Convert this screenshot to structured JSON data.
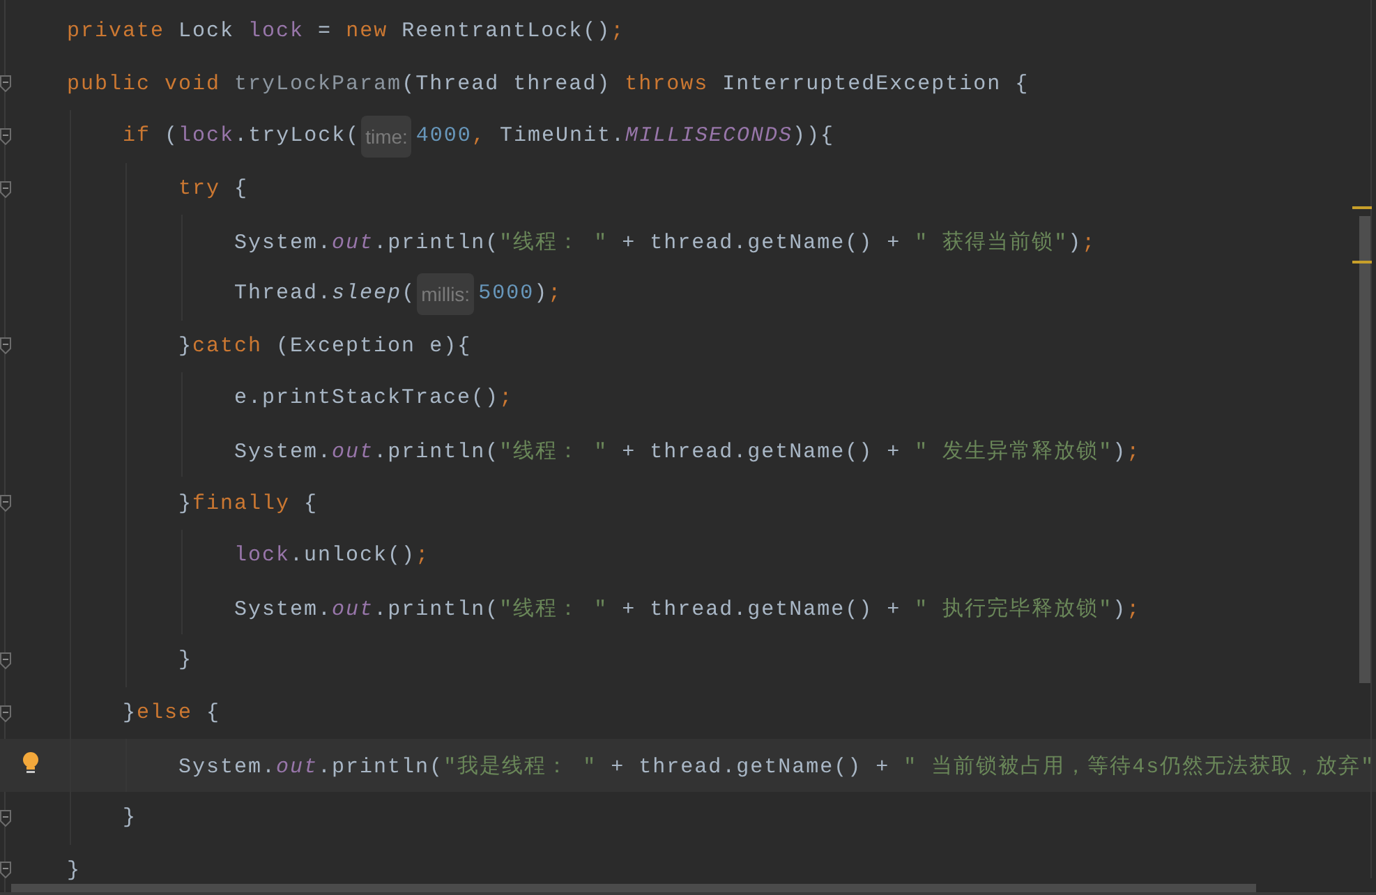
{
  "lines": [
    {
      "fold": false,
      "current": false,
      "intention_bulb": false,
      "tokens": [
        {
          "kind": "keyword",
          "text": "private"
        },
        {
          "kind": "plain",
          "text": " Lock "
        },
        {
          "kind": "field",
          "text": "lock"
        },
        {
          "kind": "plain",
          "text": " = "
        },
        {
          "kind": "keyword",
          "text": "new"
        },
        {
          "kind": "plain",
          "text": " ReentrantLock()"
        },
        {
          "kind": "keyword",
          "text": ";"
        }
      ]
    },
    {
      "fold": true,
      "current": false,
      "intention_bulb": false,
      "tokens": [
        {
          "kind": "keyword",
          "text": "public void "
        },
        {
          "kind": "declaration",
          "text": "tryLockParam"
        },
        {
          "kind": "plain",
          "text": "(Thread thread) "
        },
        {
          "kind": "keyword",
          "text": "throws"
        },
        {
          "kind": "plain",
          "text": " InterruptedException {"
        }
      ]
    },
    {
      "fold": true,
      "current": false,
      "intention_bulb": false,
      "tokens": [
        {
          "kind": "keyword",
          "text": "    if"
        },
        {
          "kind": "plain",
          "text": " ("
        },
        {
          "kind": "field",
          "text": "lock"
        },
        {
          "kind": "plain",
          "text": ".tryLock("
        },
        {
          "kind": "hint",
          "text": "time:"
        },
        {
          "kind": "number",
          "text": "4000"
        },
        {
          "kind": "keyword",
          "text": ","
        },
        {
          "kind": "plain",
          "text": " TimeUnit."
        },
        {
          "kind": "static-field",
          "text": "MILLISECONDS"
        },
        {
          "kind": "plain",
          "text": ")){"
        }
      ]
    },
    {
      "fold": true,
      "current": false,
      "intention_bulb": false,
      "tokens": [
        {
          "kind": "keyword",
          "text": "        try"
        },
        {
          "kind": "plain",
          "text": " {"
        }
      ]
    },
    {
      "fold": false,
      "current": false,
      "intention_bulb": false,
      "tokens": [
        {
          "kind": "plain",
          "text": "            System."
        },
        {
          "kind": "static-field",
          "text": "out"
        },
        {
          "kind": "plain",
          "text": ".println("
        },
        {
          "kind": "string",
          "text": "\"线程： \""
        },
        {
          "kind": "plain",
          "text": " + thread.getName() + "
        },
        {
          "kind": "string",
          "text": "\" 获得当前锁\""
        },
        {
          "kind": "plain",
          "text": ")"
        },
        {
          "kind": "keyword",
          "text": ";"
        }
      ]
    },
    {
      "fold": false,
      "current": false,
      "intention_bulb": false,
      "tokens": [
        {
          "kind": "plain",
          "text": "            Thread."
        },
        {
          "kind": "static-method",
          "text": "sleep"
        },
        {
          "kind": "plain",
          "text": "("
        },
        {
          "kind": "hint",
          "text": "millis:"
        },
        {
          "kind": "number",
          "text": "5000"
        },
        {
          "kind": "plain",
          "text": ")"
        },
        {
          "kind": "keyword",
          "text": ";"
        }
      ]
    },
    {
      "fold": true,
      "current": false,
      "intention_bulb": false,
      "tokens": [
        {
          "kind": "plain",
          "text": "        }"
        },
        {
          "kind": "keyword",
          "text": "catch"
        },
        {
          "kind": "plain",
          "text": " (Exception e){"
        }
      ]
    },
    {
      "fold": false,
      "current": false,
      "intention_bulb": false,
      "tokens": [
        {
          "kind": "plain",
          "text": "            e.printStackTrace()"
        },
        {
          "kind": "keyword",
          "text": ";"
        }
      ]
    },
    {
      "fold": false,
      "current": false,
      "intention_bulb": false,
      "tokens": [
        {
          "kind": "plain",
          "text": "            System."
        },
        {
          "kind": "static-field",
          "text": "out"
        },
        {
          "kind": "plain",
          "text": ".println("
        },
        {
          "kind": "string",
          "text": "\"线程： \""
        },
        {
          "kind": "plain",
          "text": " + thread.getName() + "
        },
        {
          "kind": "string",
          "text": "\" 发生异常释放锁\""
        },
        {
          "kind": "plain",
          "text": ")"
        },
        {
          "kind": "keyword",
          "text": ";"
        }
      ]
    },
    {
      "fold": true,
      "current": false,
      "intention_bulb": false,
      "tokens": [
        {
          "kind": "plain",
          "text": "        }"
        },
        {
          "kind": "keyword",
          "text": "finally"
        },
        {
          "kind": "plain",
          "text": " {"
        }
      ]
    },
    {
      "fold": false,
      "current": false,
      "intention_bulb": false,
      "tokens": [
        {
          "kind": "field",
          "text": "            lock"
        },
        {
          "kind": "plain",
          "text": ".unlock()"
        },
        {
          "kind": "keyword",
          "text": ";"
        }
      ]
    },
    {
      "fold": false,
      "current": false,
      "intention_bulb": false,
      "tokens": [
        {
          "kind": "plain",
          "text": "            System."
        },
        {
          "kind": "static-field",
          "text": "out"
        },
        {
          "kind": "plain",
          "text": ".println("
        },
        {
          "kind": "string",
          "text": "\"线程： \""
        },
        {
          "kind": "plain",
          "text": " + thread.getName() + "
        },
        {
          "kind": "string",
          "text": "\" 执行完毕释放锁\""
        },
        {
          "kind": "plain",
          "text": ")"
        },
        {
          "kind": "keyword",
          "text": ";"
        }
      ]
    },
    {
      "fold": true,
      "current": false,
      "intention_bulb": false,
      "tokens": [
        {
          "kind": "plain",
          "text": "        }"
        }
      ]
    },
    {
      "fold": true,
      "current": false,
      "intention_bulb": false,
      "tokens": [
        {
          "kind": "plain",
          "text": "    }"
        },
        {
          "kind": "keyword",
          "text": "else"
        },
        {
          "kind": "plain",
          "text": " {"
        }
      ]
    },
    {
      "fold": false,
      "current": true,
      "intention_bulb": true,
      "tokens": [
        {
          "kind": "plain",
          "text": "        System."
        },
        {
          "kind": "static-field",
          "text": "out"
        },
        {
          "kind": "plain",
          "text": ".println("
        },
        {
          "kind": "string",
          "text": "\"我是线程： \""
        },
        {
          "kind": "plain",
          "text": " + thread.getName() + "
        },
        {
          "kind": "string",
          "text": "\" 当前锁被占用，等待4s仍然无法获取，放弃\""
        }
      ]
    },
    {
      "fold": true,
      "current": false,
      "intention_bulb": false,
      "tokens": [
        {
          "kind": "plain",
          "text": "    }"
        }
      ]
    },
    {
      "fold": true,
      "current": false,
      "intention_bulb": false,
      "tokens": [
        {
          "kind": "plain",
          "text": "}"
        }
      ]
    }
  ]
}
